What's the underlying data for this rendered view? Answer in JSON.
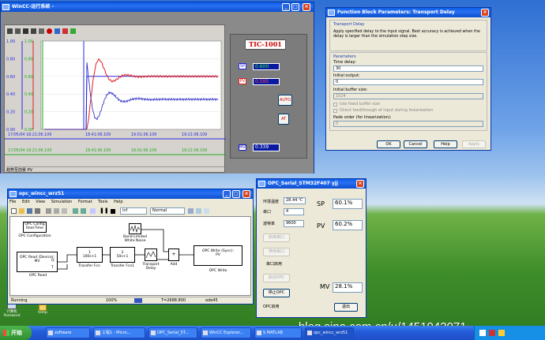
{
  "desktop": {
    "icon1_label": "计算机\nPassword",
    "icon2_label": "temp",
    "watermark": "blog.sina.com.cn/u/1451942071"
  },
  "wincc": {
    "title": "WinCC-运行系统 -",
    "tag": "TIC-1001",
    "sp_label": "SP",
    "sp_value": "0.600",
    "pv_label": "PV",
    "pv_value": "0.595",
    "mv_label": "MV",
    "mv_value": "0.339",
    "auto_button": "AUTO",
    "at_button": "AT",
    "y_ticks_left": [
      "1.00",
      "0.80",
      "0.60",
      "0.40",
      "0.20",
      "0.00"
    ],
    "y_ticks_right": [
      "1.00",
      "0.80",
      "0.60",
      "0.40",
      "0.20",
      "0.00"
    ],
    "x_ticks": [
      "17/05/04  18:21:06.109",
      "18:41:06.109",
      "19:01:06.109",
      "19:21:06.109"
    ],
    "x_ticks_row2": [
      "17/05/04  18:21:06.109",
      "18:41:06.109",
      "19:01:06.109",
      "19:21:06.109"
    ],
    "status": "趋势至前景  PV",
    "colors": {
      "sp": "#2a2ae0",
      "pv": "#e02020",
      "mv": "#2020c0",
      "axis_green": "#22aa22"
    }
  },
  "fbp": {
    "title": "Function Block Parameters: Transport Delay",
    "section": "Transport Delay",
    "description": "Apply specified delay to the input signal.  Best accuracy is achieved when the delay is larger than the simulation step size.",
    "params_label": "Parameters",
    "time_delay_label": "Time delay:",
    "time_delay_value": "30",
    "initial_output_label": "Initial output:",
    "initial_output_value": "0",
    "initial_buffer_label": "Initial buffer size:",
    "initial_buffer_value": "1024",
    "fixed_buffer_label": "Use fixed buffer size",
    "direct_feed_label": "Direct feedthrough of input during linearization",
    "pade_label": "Pade order (for linearization):",
    "pade_value": "0",
    "ok": "OK",
    "cancel": "Cancel",
    "help": "Help",
    "apply": "Apply"
  },
  "simulink": {
    "title": "opc_wincc_wrz51",
    "menu": [
      "File",
      "Edit",
      "View",
      "Simulation",
      "Format",
      "Tools",
      "Help"
    ],
    "stop_time": "inf",
    "mode": "Normal",
    "blocks": {
      "opc_config": "OPC Config\nReal-Time",
      "opc_config_cap": "OPC Configuration",
      "opc_read": "OPC Read (Device):\nMV",
      "opc_read_cap": "OPC Read",
      "tf1": "1\n100s+1",
      "tf1_cap": "Transfer Fcn",
      "tf2": "2\n50s+1",
      "tf2_cap": "Transfer Fcn1",
      "noise_cap": "Band-Limited\nWhite Noise",
      "delay_cap": "Transport\nDelay",
      "add_cap": "Add",
      "opc_write": "OPC Write (Sync):\nPV",
      "opc_write_cap": "OPC Write",
      "port_q": "Q",
      "port_t": "T"
    },
    "status_running": "Running",
    "status_zoom": "100%",
    "status_time": "T=2688.800",
    "status_solver": "ode45"
  },
  "serial": {
    "title": "OPC_Serial_STM32F407 yjj",
    "temp_label": "环境温度",
    "temp_value": "28.44 ℃",
    "port_label": "串口",
    "port_value": "4",
    "baud_label": "波特率",
    "baud_value": "9600",
    "open_port": "启用串口",
    "close_port": "停用串口",
    "port_enabled": "串口启用",
    "start_opc": "启动OPC",
    "stop_opc": "停止OPC",
    "opc_enabled": "OPC启用",
    "exit": "退出",
    "sp_label": "SP",
    "sp_value": "60.1%",
    "pv_label": "PV",
    "pv_value": "60.2%",
    "mv_label": "MV",
    "mv_value": "28.1%"
  },
  "taskbar": {
    "start": "开始",
    "tasks": [
      "zoftware",
      "工程1 - Micro...",
      "OPC_Serial_ST...",
      "WinCC Explorer...",
      "S MATLAB",
      "opc_wincc_wrz51"
    ],
    "active_index": 5
  }
}
